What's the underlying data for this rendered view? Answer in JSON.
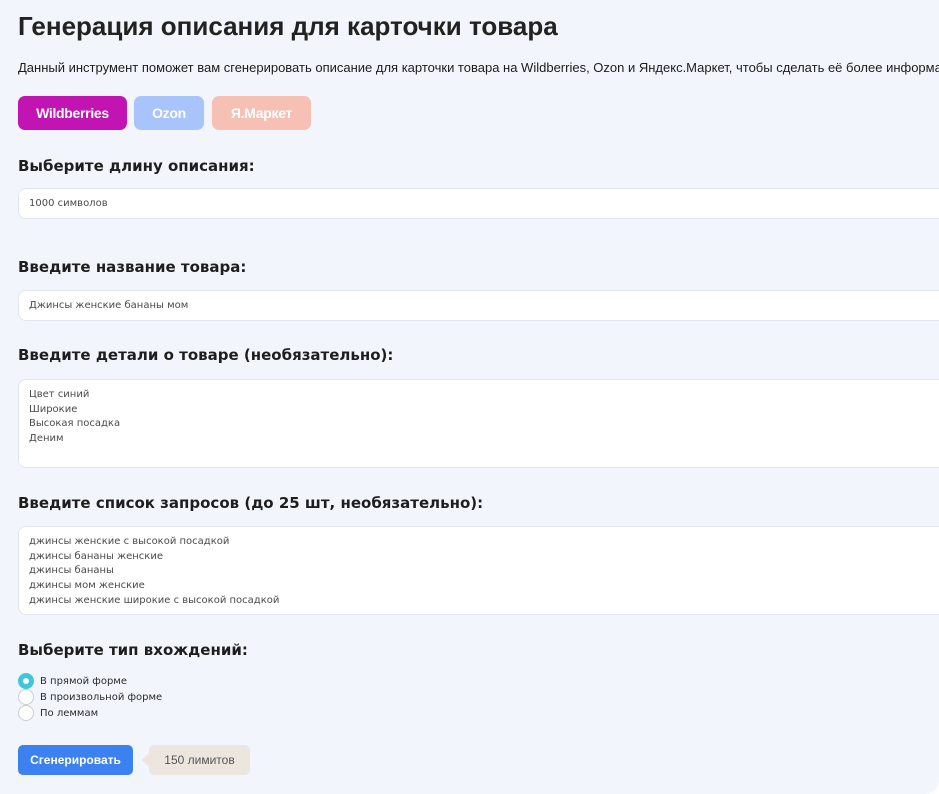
{
  "title": "Генерация описания для карточки товара",
  "intro": "Данный инструмент поможет вам сгенерировать описание для карточки товара на Wildberries, Ozon и Яндекс.Маркет, чтобы сделать её более информативной, а",
  "marketplaces": [
    {
      "label": "Wildberries",
      "active": true,
      "color": "#c213b3"
    },
    {
      "label": "Ozon",
      "active": false,
      "color": "#a9c3fb"
    },
    {
      "label": "Я.Маркет",
      "active": false,
      "color": "#f6c0b4"
    }
  ],
  "length": {
    "label": "Выберите длину описания:",
    "value": "1000 символов"
  },
  "product_name": {
    "label": "Введите название товара:",
    "value": "Джинсы  женские бананы мом"
  },
  "details": {
    "label": "Введите детали о товаре (необязательно):",
    "lines": [
      "Цвет синий",
      "Широкие",
      "Высокая посадка",
      "Деним"
    ]
  },
  "queries": {
    "label": "Введите список запросов (до 25 шт, необязательно):",
    "lines": [
      "джинсы женские с высокой посадкой",
      "джинсы бананы женские",
      "джинсы бананы",
      "джинсы мом женские",
      "джинсы женские широкие с высокой посадкой"
    ]
  },
  "occurrence": {
    "label": "Выберите тип вхождений:",
    "options": [
      {
        "label": "В прямой форме",
        "checked": true
      },
      {
        "label": "В произвольной форме",
        "checked": false
      },
      {
        "label": "По леммам",
        "checked": false
      }
    ],
    "accent_color": "#3fc7d8"
  },
  "generate_button": "Сгенерировать",
  "limits_badge": "150 лимитов",
  "colors": {
    "background": "#f2f6fc",
    "primary_button": "#3b82f0",
    "badge": "#ece6df"
  }
}
